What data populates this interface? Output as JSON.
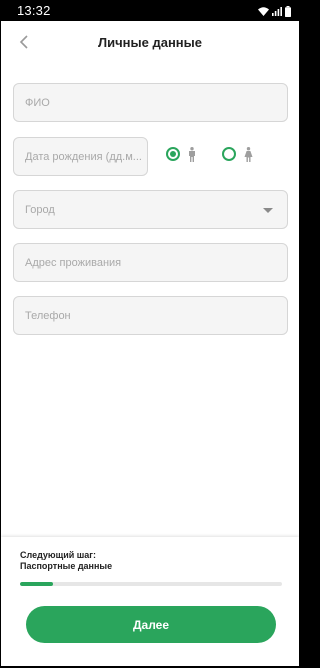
{
  "status_bar": {
    "time": "13:32",
    "icons": [
      "wifi-icon",
      "signal-icon",
      "battery-icon"
    ]
  },
  "header": {
    "title": "Личные данные",
    "back_icon": "chevron-left-icon"
  },
  "form": {
    "full_name": {
      "placeholder": "ФИО",
      "value": ""
    },
    "birth_date": {
      "placeholder": "Дата рождения (дд.м...",
      "value": ""
    },
    "gender": {
      "options": [
        {
          "icon": "male-icon",
          "selected": true
        },
        {
          "icon": "female-icon",
          "selected": false
        }
      ]
    },
    "city": {
      "placeholder": "Город",
      "value": ""
    },
    "address": {
      "placeholder": "Адрес проживания",
      "value": ""
    },
    "phone": {
      "placeholder": "Телефон",
      "value": ""
    }
  },
  "footer": {
    "next_step_title": "Следующий шаг:",
    "next_step_name": "Паспортные данные",
    "progress": 0.125,
    "next_button": "Далее"
  },
  "colors": {
    "accent": "#2aa55c",
    "field_bg": "#f5f5f5",
    "field_border": "#d6d6d6",
    "placeholder": "#a9a9a9"
  }
}
